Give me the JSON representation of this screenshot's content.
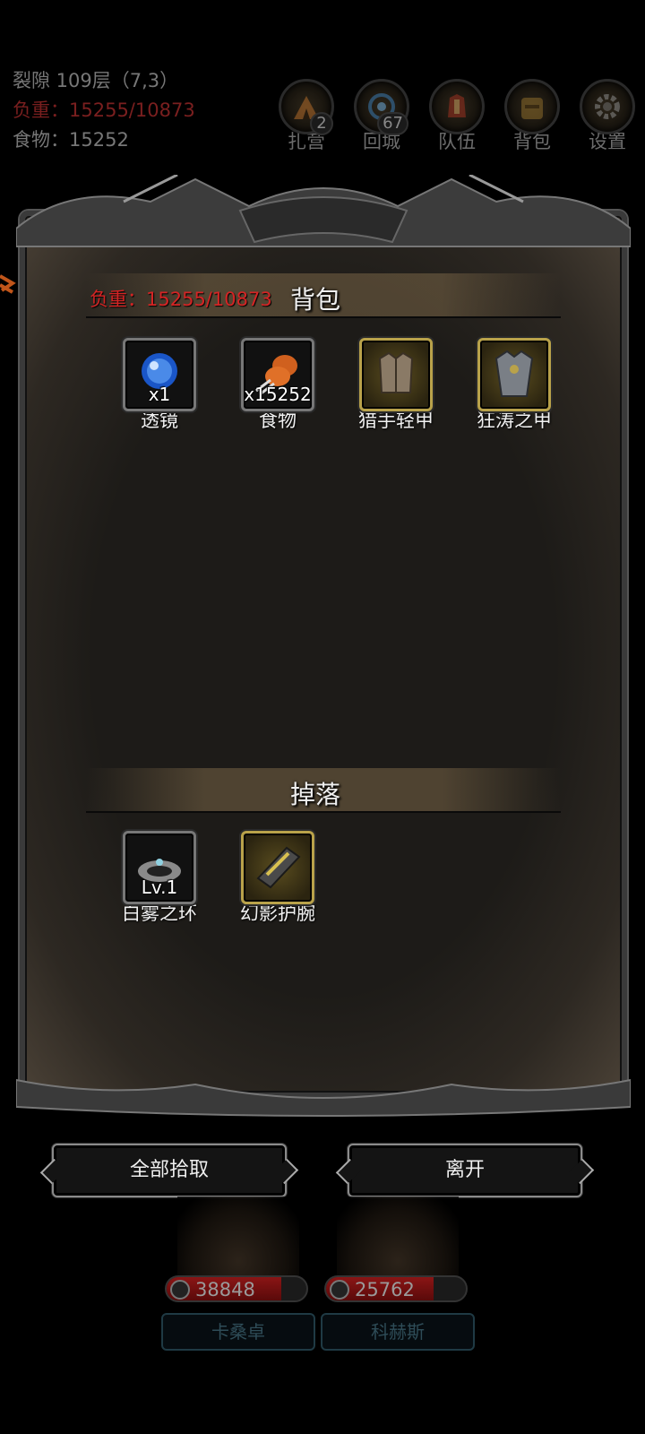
{
  "status": {
    "location": "裂隙 109层（7,3）",
    "weight": "负重：15255/10873",
    "food": "食物：15252"
  },
  "nav": [
    {
      "label": "扎营",
      "badge": "2",
      "icon": "camp-icon"
    },
    {
      "label": "回城",
      "badge": "67",
      "icon": "portal-icon"
    },
    {
      "label": "队伍",
      "badge": "",
      "icon": "team-icon"
    },
    {
      "label": "背包",
      "badge": "",
      "icon": "backpack-icon"
    },
    {
      "label": "设置",
      "badge": "",
      "icon": "gear-icon"
    }
  ],
  "bag": {
    "weight": "负重：15255/10873",
    "title": "背包",
    "items": [
      {
        "name": "透镜",
        "count": "x1"
      },
      {
        "name": "食物",
        "count": "x15252"
      },
      {
        "name": "猎手轻甲",
        "count": ""
      },
      {
        "name": "狂涛之甲",
        "count": ""
      }
    ]
  },
  "drops": {
    "title": "掉落",
    "items": [
      {
        "name": "白雾之环",
        "count": "Lv.1"
      },
      {
        "name": "幻影护腕",
        "count": ""
      }
    ]
  },
  "buttons": {
    "pickup_all": "全部拾取",
    "leave": "离开"
  },
  "party": [
    {
      "name": "卡桑卓",
      "hp": "38848",
      "hp_fill": 0.82
    },
    {
      "name": "科赫斯",
      "hp": "25762",
      "hp_fill": 0.77
    }
  ],
  "colors": {
    "weight_red": "#d42424",
    "gold_frame": "#b9a24a"
  }
}
